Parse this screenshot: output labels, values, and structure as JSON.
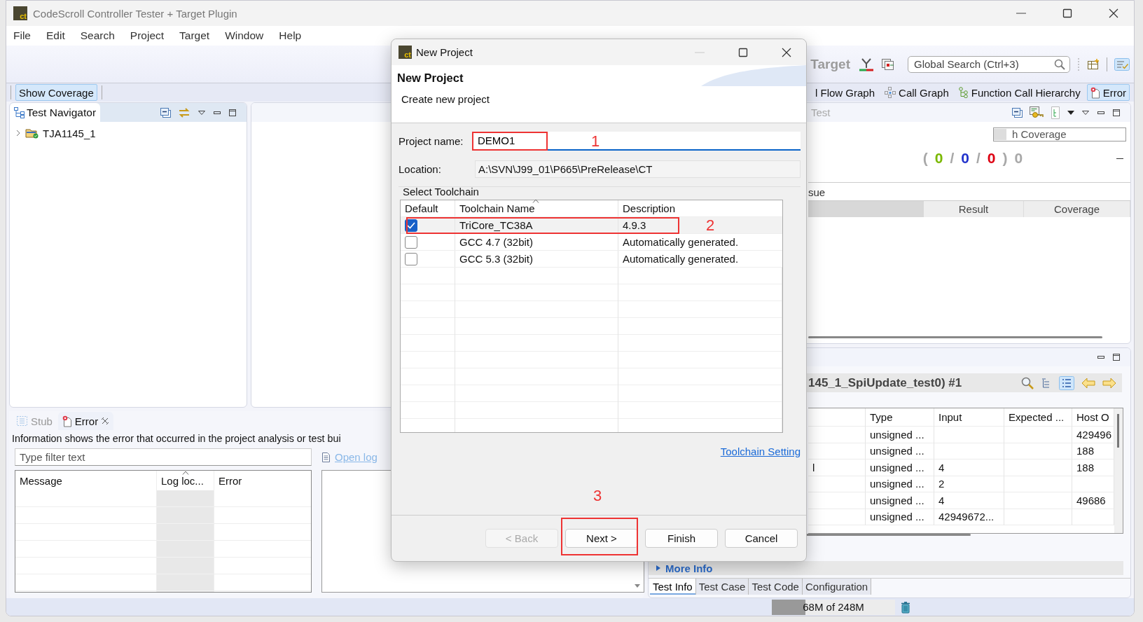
{
  "window": {
    "logo": "ct",
    "title": "CodeScroll Controller Tester + Target Plugin"
  },
  "menu": [
    "File",
    "Edit",
    "Search",
    "Project",
    "Target",
    "Window",
    "Help"
  ],
  "toolbar": {
    "target_label": "Target",
    "target_disabled": true,
    "search_placeholder": "Global Search (Ctrl+3)"
  },
  "perspective_bar": {
    "left": [
      {
        "label": "Show Coverage",
        "selected": true
      }
    ],
    "right": [
      {
        "label": "l Flow Graph",
        "selected": false
      },
      {
        "label": "Call Graph",
        "selected": false
      },
      {
        "label": "Function Call Hierarchy",
        "selected": false
      },
      {
        "label": "Error",
        "selected": true
      }
    ]
  },
  "navigator": {
    "title": "Test Navigator",
    "tree": [
      {
        "label": "TJA1145_1",
        "expanded": false
      }
    ]
  },
  "test_panel": {
    "tab": "Test",
    "coverage_combo": "h Coverage",
    "counts": [
      {
        "text": "(",
        "color": "#a8a8a8"
      },
      {
        "text": "0",
        "color": "#7ab800"
      },
      {
        "text": "/",
        "color": "#a8a8a8"
      },
      {
        "text": "0",
        "color": "#2233cc"
      },
      {
        "text": "/",
        "color": "#a8a8a8"
      },
      {
        "text": "0",
        "color": "#dd0011"
      },
      {
        "text": ")",
        "color": "#a8a8a8"
      },
      {
        "text": "0",
        "color": "#a8a8a8"
      }
    ],
    "section": "sue",
    "columns": [
      "Result",
      "Coverage"
    ]
  },
  "error_panel": {
    "tabs": [
      {
        "label": "Stub",
        "selected": false,
        "closable": false
      },
      {
        "label": "Error",
        "selected": true,
        "closable": true
      }
    ],
    "info": "Information shows the error that occurred in the project analysis or test bui",
    "filter_placeholder": "Type filter text",
    "open_log": "Open log",
    "columns": [
      "Message",
      "Log loc...",
      "Error"
    ]
  },
  "data_panel": {
    "title": "145_1_SpiUpdate_test0) #1",
    "columns": [
      "Type",
      "Input",
      "Expected ...",
      "Host O"
    ],
    "rows": [
      {
        "type": "unsigned ...",
        "host": "429496"
      },
      {
        "type": "unsigned ...",
        "host": "188"
      },
      {
        "column_1": "l",
        "type": "unsigned ...",
        "input": "4",
        "host": "188"
      },
      {
        "type": "unsigned ...",
        "input": "2"
      },
      {
        "type": "unsigned ...",
        "input": "4",
        "host": "49686"
      },
      {
        "type": "unsigned ...",
        "input": "42949672..."
      }
    ],
    "more_info": "More Info",
    "tabs": [
      {
        "label": "Test Info",
        "selected": true
      },
      {
        "label": "Test Case",
        "selected": false
      },
      {
        "label": "Test Code",
        "selected": false
      },
      {
        "label": "Configuration",
        "selected": false
      }
    ]
  },
  "status_bar": {
    "heap": "68M of 248M",
    "level": 0.27
  },
  "dialog": {
    "logo": "ct",
    "title": "New Project",
    "heading": "New Project",
    "subtitle": "Create new project",
    "project_name": {
      "label": "Project name:",
      "value": "DEMO1",
      "annotation": "1"
    },
    "location": {
      "label": "Location:",
      "value": "A:\\SVN\\J99_01\\P665\\PreRelease\\CT"
    },
    "toolchain": {
      "title": "Select Toolchain",
      "columns": [
        "Default",
        "Toolchain Name",
        "Description"
      ],
      "rows": [
        {
          "checked": true,
          "selected": true,
          "name": "TriCore_TC38A",
          "description": "4.9.3",
          "annotation": "2"
        },
        {
          "checked": false,
          "selected": false,
          "name": "GCC 4.7 (32bit)",
          "description": "Automatically generated."
        },
        {
          "checked": false,
          "selected": false,
          "name": "GCC 5.3 (32bit)",
          "description": "Automatically generated."
        }
      ]
    },
    "setting_link": "Toolchain Setting",
    "buttons": [
      {
        "label": "< Back",
        "disabled": true
      },
      {
        "label": "Next >",
        "disabled": false,
        "annotation": "3"
      },
      {
        "label": "Finish",
        "disabled": false
      },
      {
        "label": "Cancel",
        "disabled": false
      }
    ]
  }
}
